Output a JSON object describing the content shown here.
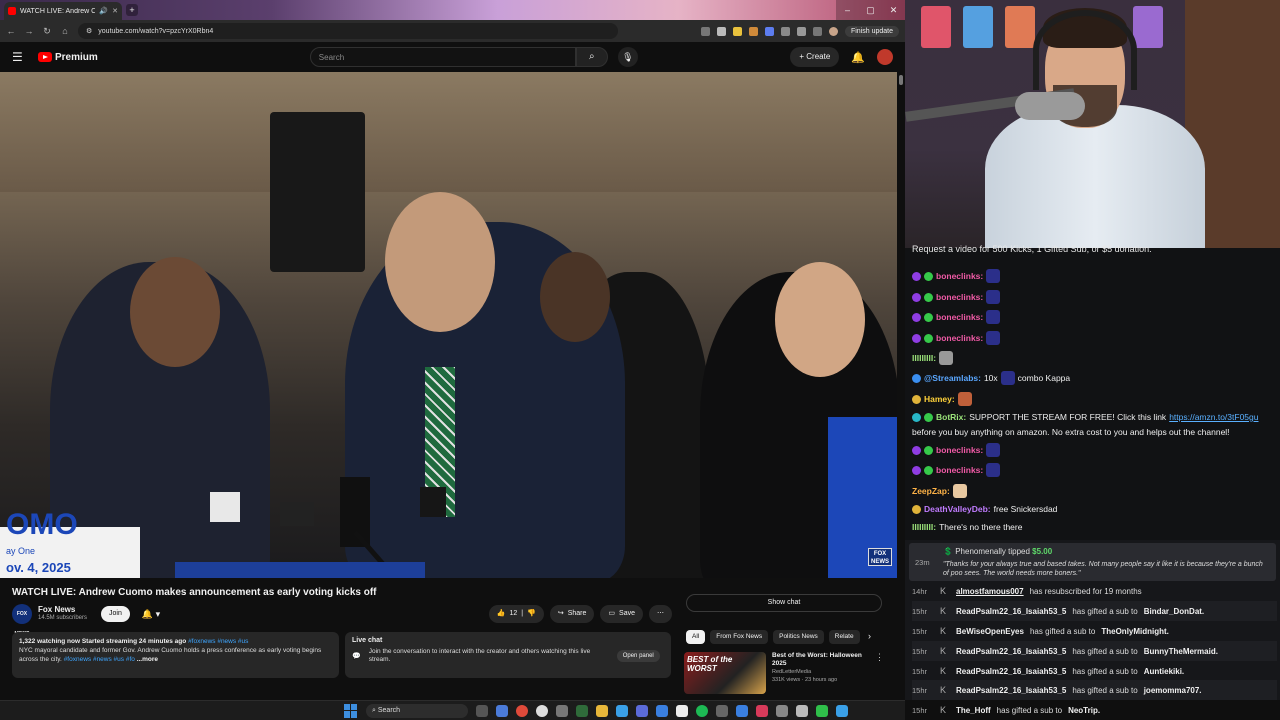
{
  "browser": {
    "tab_title": "WATCH LIVE: Andrew Cuomo",
    "url": "youtube.com/watch?v=pzcYrX0Rbn4",
    "finish_update": "Finish update"
  },
  "youtube": {
    "logo_text": "Premium",
    "search_placeholder": "Search",
    "create_label": "Create",
    "video": {
      "sign_text": "OMO",
      "sign_sub": "ay One",
      "sign_date": "ov. 4, 2025",
      "bug_text": "FOX NEWS"
    },
    "title": "WATCH LIVE: Andrew Cuomo makes announcement as early voting kicks off",
    "channel": {
      "name": "Fox News",
      "subscribers": "14.5M subscribers",
      "avatar_text": "FOX NEWS",
      "join_label": "Join"
    },
    "actions": {
      "likes": "12",
      "share": "Share",
      "save": "Save"
    },
    "description": {
      "stats": "1,322 watching now  Started streaming 24 minutes ago",
      "tags1": "#foxnews #news #us",
      "body": "NYC mayoral candidate and former Gov. Andrew Cuomo holds a press conference as early voting begins across the city.",
      "tags2": "#foxnews #news #us #fo",
      "more": "...more"
    },
    "live_chat": {
      "title": "Live chat",
      "desc": "Join the conversation to interact with the creator and others watching this live stream.",
      "open_panel": "Open panel"
    },
    "show_chat": "Show chat",
    "chips": [
      "All",
      "From Fox News",
      "Politics News",
      "Relate"
    ],
    "recommendation": {
      "thumb_text": "BEST of the WORST",
      "title": "Best of the Worst: Halloween 2025",
      "channel": "RedLetterMedia",
      "meta": "331K views · 23 hours ago"
    }
  },
  "taskbar": {
    "search": "Search"
  },
  "kick_chat": {
    "banner": "Request a video for 500 Kicks, 1 Gifted Sub, or $5 donation.",
    "messages": [
      {
        "user": "boneclinks:",
        "text": "",
        "user_color": "#f05aa6"
      },
      {
        "user": "boneclinks:",
        "text": "",
        "user_color": "#f05aa6"
      },
      {
        "user": "boneclinks:",
        "text": "",
        "user_color": "#f05aa6"
      },
      {
        "user": "boneclinks:",
        "text": "",
        "user_color": "#f05aa6"
      },
      {
        "user": "IIIIIIIII:",
        "text": "",
        "user_color": "#9be37a"
      },
      {
        "user": "@Streamlabs:",
        "text": "10x",
        "text2": "combo Kappa",
        "user_color": "#5aa7ff"
      },
      {
        "user": "Hamey:",
        "text": "",
        "user_color": "#ffd23a"
      },
      {
        "user": "BotRix:",
        "text": "SUPPORT THE STREAM FOR FREE! Click this link",
        "link": "https://amzn.to/3tF05gu",
        "text2": "before you buy anything on amazon. No extra cost to you and helps out the channel!",
        "user_color": "#9be37a"
      },
      {
        "user": "boneclinks:",
        "text": "",
        "user_color": "#f05aa6"
      },
      {
        "user": "boneclinks:",
        "text": "",
        "user_color": "#f05aa6"
      },
      {
        "user": "ZeepZap:",
        "text": "",
        "user_color": "#ffb347"
      },
      {
        "user": "DeathValleyDeb:",
        "text": "free Snickersdad",
        "user_color": "#c07cff"
      },
      {
        "user": "IIIIIIIII:",
        "text": "There's no there there",
        "user_color": "#9be37a"
      }
    ],
    "tip": {
      "time": "23m",
      "user": "Phenomenally",
      "verb": "tipped",
      "amount": "$5.00",
      "message": "\"Thanks for your always true and based takes. Not many people say it like it is because they're a bunch of poo sees. The world needs more boners.\""
    },
    "events": [
      {
        "time": "14hr",
        "user": "almostfamous007",
        "text": "has resubscribed for 19 months",
        "target": ""
      },
      {
        "time": "15hr",
        "user": "ReadPsalm22_16_Isaiah53_5",
        "text": "has gifted a sub to",
        "target": "Bindar_DonDat."
      },
      {
        "time": "15hr",
        "user": "BeWiseOpenEyes",
        "text": "has gifted a sub to",
        "target": "TheOnlyMidnight."
      },
      {
        "time": "15hr",
        "user": "ReadPsalm22_16_Isaiah53_5",
        "text": "has gifted a sub to",
        "target": "BunnyTheMermaid."
      },
      {
        "time": "15hr",
        "user": "ReadPsalm22_16_Isaiah53_5",
        "text": "has gifted a sub to",
        "target": "Auntiekiki."
      },
      {
        "time": "15hr",
        "user": "ReadPsalm22_16_Isaiah53_5",
        "text": "has gifted a sub to",
        "target": "joemomma707."
      },
      {
        "time": "15hr",
        "user": "The_Hoff",
        "text": "has gifted a sub to",
        "target": "NeoTrip."
      }
    ]
  }
}
